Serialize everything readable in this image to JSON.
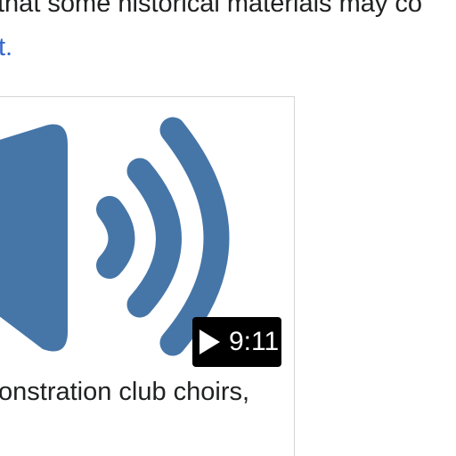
{
  "article": {
    "intro_line": "that some historical materials may co",
    "intro_link": "t."
  },
  "media": {
    "thumbnail_icon": "speaker-volume-icon",
    "duration": "9:11",
    "caption": "onstration club choirs,",
    "icon_color": "#4676a8",
    "badge_color": "#000000"
  }
}
